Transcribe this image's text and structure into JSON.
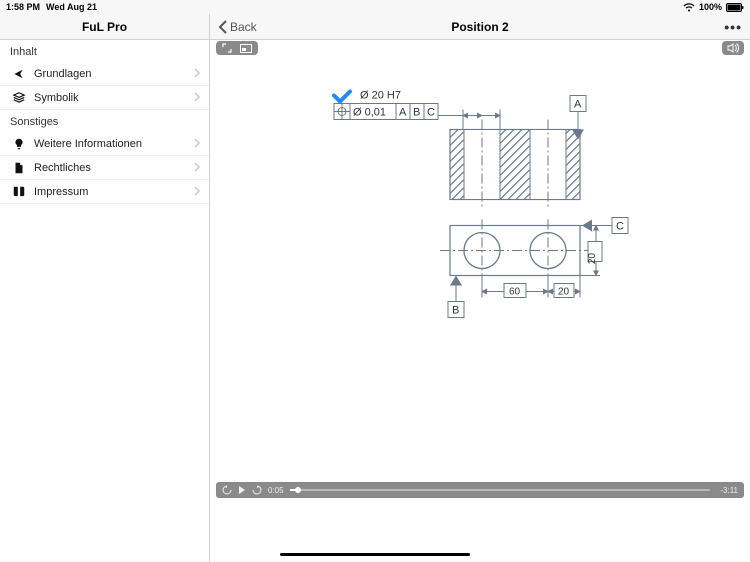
{
  "status": {
    "time": "1:58 PM",
    "date": "Wed Aug 21",
    "battery": "100%"
  },
  "sidebar": {
    "title": "FuL Pro",
    "sections": [
      {
        "header": "Inhalt",
        "items": [
          {
            "label": "Grundlagen",
            "icon": "share-icon"
          },
          {
            "label": "Symbolik",
            "icon": "stack-icon"
          }
        ]
      },
      {
        "header": "Sonstiges",
        "items": [
          {
            "label": "Weitere Informationen",
            "icon": "bulb-icon"
          },
          {
            "label": "Rechtliches",
            "icon": "doc-icon"
          },
          {
            "label": "Impressum",
            "icon": "book-icon"
          }
        ]
      }
    ]
  },
  "nav": {
    "back": "Back",
    "title": "Position 2"
  },
  "player": {
    "elapsed": "0:05",
    "remaining": "-3:11"
  },
  "drawing": {
    "tolerance_spec": "Ø 20 H7",
    "tolerance_value": "Ø 0,01",
    "tolerance_refs": [
      "A",
      "B",
      "C"
    ],
    "datum_a": "A",
    "datum_b": "B",
    "datum_c": "C",
    "dim_60": "60",
    "dim_20": "20",
    "dim_20v": "20"
  }
}
